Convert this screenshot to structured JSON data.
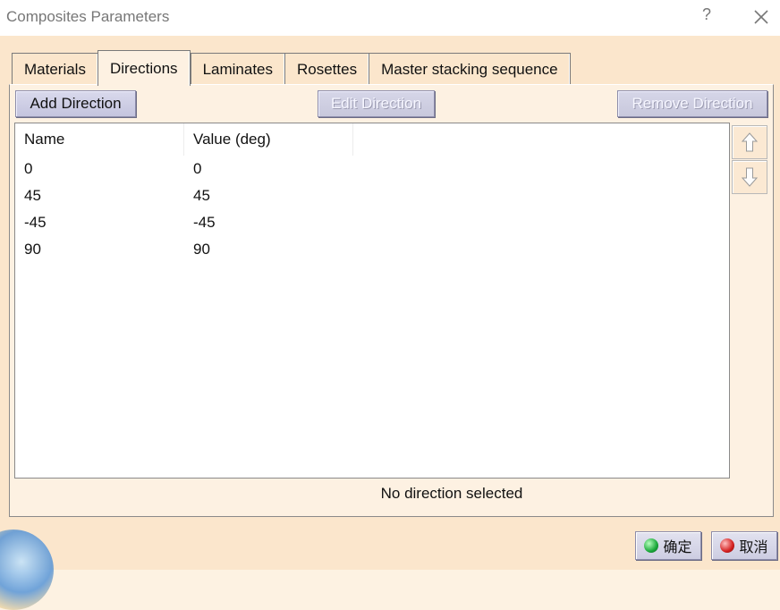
{
  "window": {
    "title": "Composites Parameters",
    "help_label": "?"
  },
  "tabs": [
    {
      "label": "Materials",
      "active": false
    },
    {
      "label": "Directions",
      "active": true
    },
    {
      "label": "Laminates",
      "active": false
    },
    {
      "label": "Rosettes",
      "active": false
    },
    {
      "label": "Master stacking sequence",
      "active": false
    }
  ],
  "toolbar": {
    "add_label": "Add Direction",
    "edit_label": "Edit Direction",
    "remove_label": "Remove Direction"
  },
  "table": {
    "columns": [
      "Name",
      "Value (deg)"
    ],
    "rows": [
      [
        "0",
        "0"
      ],
      [
        "45",
        "45"
      ],
      [
        "-45",
        "-45"
      ],
      [
        "90",
        "90"
      ]
    ]
  },
  "status": "No direction selected",
  "footer": {
    "ok_label": "确定",
    "cancel_label": "取消"
  },
  "colors": {
    "dialog_bg": "#fbe6cc",
    "ok_indicator": "#1aa83a",
    "cancel_indicator": "#d42020"
  },
  "icons": {
    "move_up": "arrow-up-icon",
    "move_down": "arrow-down-icon",
    "close": "close-icon"
  }
}
